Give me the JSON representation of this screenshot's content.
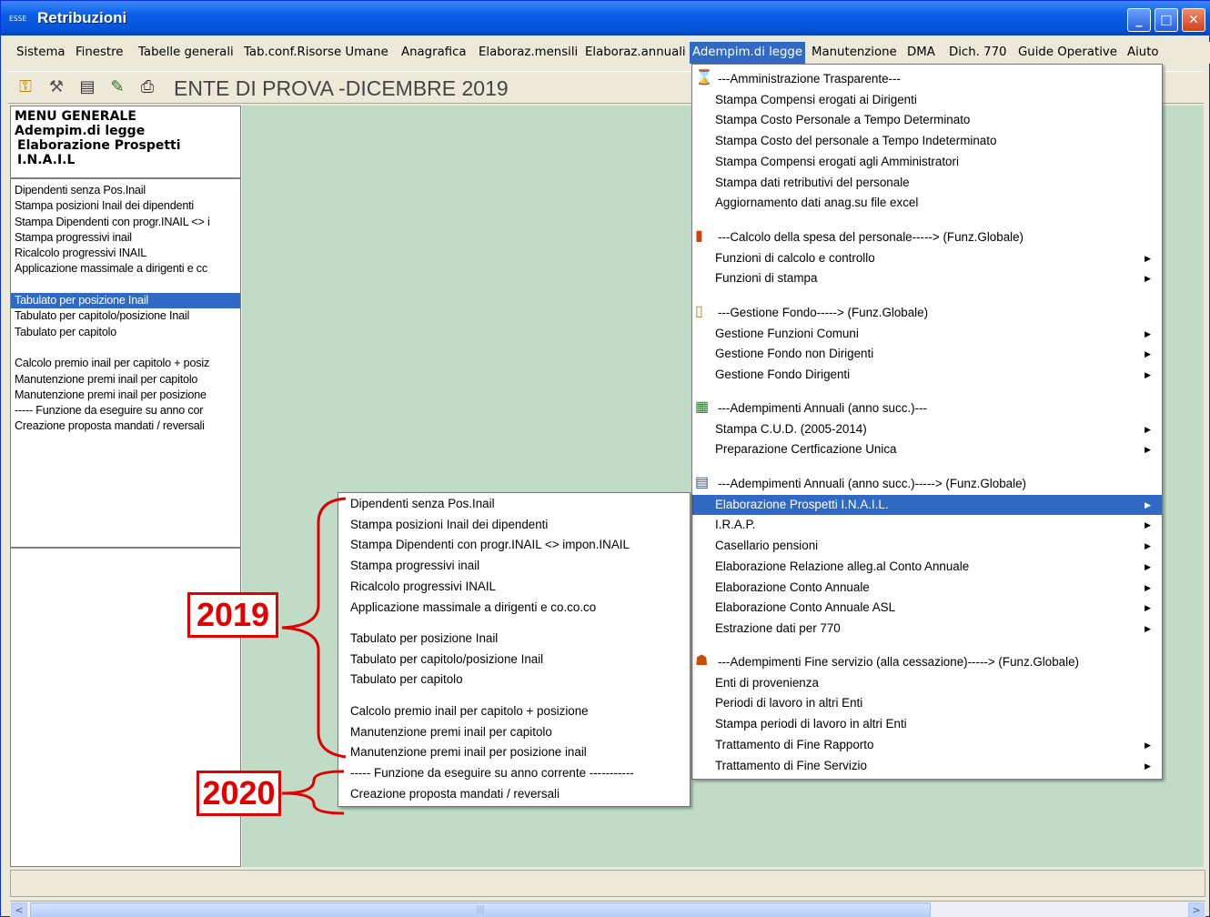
{
  "window": {
    "title": "Retribuzioni",
    "app_icon_text": "ESSE"
  },
  "menubar": [
    "Sistema",
    "Finestre",
    "Tabelle generali",
    "Tab.conf.Risorse Umane",
    "Anagrafica",
    "Elaboraz.mensili",
    "Elaboraz.annuali",
    "Adempim.di legge",
    "Manutenzione",
    "DMA",
    "Dich. 770",
    "Guide Operative",
    "Aiuto"
  ],
  "menubar_active": "Adempim.di legge",
  "toolbar": {
    "ente_label": "ENTE DI PROVA -DICEMBRE 2019",
    "icons": [
      "key-icon",
      "tools-icon",
      "form-icon",
      "edit-icon",
      "printer-icon"
    ]
  },
  "left_panel": {
    "header": [
      "MENU GENERALE",
      "Adempim.di legge",
      "Elaborazione Prospetti I.N.A.I.L"
    ],
    "items": [
      "Dipendenti senza Pos.Inail",
      "Stampa posizioni Inail dei dipendenti",
      "Stampa Dipendenti con progr.INAIL <> i",
      "Stampa progressivi inail",
      "Ricalcolo progressivi INAIL",
      "Applicazione massimale a dirigenti e cc",
      "",
      "Tabulato per posizione Inail",
      "Tabulato per capitolo/posizione Inail",
      "Tabulato per capitolo",
      "",
      "Calcolo premio inail per capitolo + posiz",
      "Manutenzione premi inail per capitolo",
      "Manutenzione premi inail per posizione",
      "----- Funzione da eseguire su anno cor",
      "Creazione proposta mandati / reversali"
    ],
    "selected": "Tabulato per posizione Inail"
  },
  "adempim_menu": {
    "groups": [
      {
        "icon": "hourglass-icon",
        "items": [
          {
            "label": "---Amministrazione Trasparente---",
            "sub": false
          },
          {
            "label": "Stampa Compensi erogati ai Dirigenti",
            "sub": false
          },
          {
            "label": "Stampa Costo Personale a Tempo Determinato",
            "sub": false
          },
          {
            "label": "Stampa Costo del personale a Tempo Indeterminato",
            "sub": false
          },
          {
            "label": "Stampa Compensi erogati agli Amministratori",
            "sub": false
          },
          {
            "label": "Stampa dati retributivi del personale",
            "sub": false
          },
          {
            "label": "Aggiornamento dati anag.su file excel",
            "sub": false
          }
        ]
      },
      {
        "icon": "chart-icon",
        "items": [
          {
            "label": "---Calcolo della spesa del personale-----> (Funz.Globale)",
            "sub": false
          },
          {
            "label": "Funzioni di calcolo e controllo",
            "sub": true
          },
          {
            "label": "Funzioni di stampa",
            "sub": true
          }
        ]
      },
      {
        "icon": "clipboard-icon",
        "items": [
          {
            "label": "---Gestione Fondo-----> (Funz.Globale)",
            "sub": false
          },
          {
            "label": "Gestione Funzioni Comuni",
            "sub": true
          },
          {
            "label": "Gestione Fondo non Dirigenti",
            "sub": true
          },
          {
            "label": "Gestione Fondo Dirigenti",
            "sub": true
          }
        ]
      },
      {
        "icon": "calendar-icon",
        "items": [
          {
            "label": "---Adempimenti Annuali (anno succ.)---",
            "sub": false
          },
          {
            "label": "Stampa C.U.D. (2005-2014)",
            "sub": true
          },
          {
            "label": "Preparazione Certficazione Unica",
            "sub": true
          }
        ]
      },
      {
        "icon": "document-icon",
        "items": [
          {
            "label": "---Adempimenti Annuali (anno succ.)-----> (Funz.Globale)",
            "sub": false
          },
          {
            "label": "Elaborazione Prospetti I.N.A.I.L.",
            "sub": true
          },
          {
            "label": "I.R.A.P.",
            "sub": true
          },
          {
            "label": "Casellario pensioni",
            "sub": true
          },
          {
            "label": "Elaborazione Relazione alleg.al Conto Annuale",
            "sub": true
          },
          {
            "label": "Elaborazione Conto Annuale",
            "sub": true
          },
          {
            "label": "Elaborazione Conto Annuale ASL",
            "sub": true
          },
          {
            "label": "Estrazione dati per 770",
            "sub": true
          }
        ]
      },
      {
        "icon": "people-icon",
        "items": [
          {
            "label": "---Adempimenti Fine servizio (alla cessazione)-----> (Funz.Globale)",
            "sub": false
          },
          {
            "label": "Enti di provenienza",
            "sub": false
          },
          {
            "label": "Periodi di lavoro in altri Enti",
            "sub": false
          },
          {
            "label": "Stampa periodi di lavoro in altri Enti",
            "sub": false
          },
          {
            "label": "Trattamento di Fine Rapporto",
            "sub": true
          },
          {
            "label": "Trattamento di Fine Servizio",
            "sub": true
          }
        ]
      }
    ],
    "highlighted": "Elaborazione Prospetti I.N.A.I.L."
  },
  "inail_submenu": {
    "groups": [
      [
        "Dipendenti senza Pos.Inail",
        "Stampa posizioni Inail dei dipendenti",
        "Stampa Dipendenti con progr.INAIL <> impon.INAIL",
        "Stampa progressivi inail",
        "Ricalcolo progressivi INAIL",
        "Applicazione massimale a dirigenti e co.co.co"
      ],
      [
        "Tabulato per posizione Inail",
        "Tabulato per capitolo/posizione Inail",
        "Tabulato per capitolo"
      ],
      [
        "Calcolo premio inail per capitolo + posizione",
        "Manutenzione premi inail per capitolo",
        "Manutenzione premi inail per posizione inail",
        "----- Funzione da eseguire su anno corrente -----------",
        "Creazione proposta mandati / reversali"
      ]
    ]
  },
  "annotations": {
    "label_2019": "2019",
    "label_2020": "2020",
    "color": "#e00000"
  },
  "scrollbar": {
    "left_arrow": "<",
    "right_arrow": ">",
    "grip": "|||"
  },
  "colors": {
    "titlebar": "#0553d6",
    "highlight": "#316ac5",
    "mdi_background": "#c0dcc6",
    "chrome": "#ece9d8"
  }
}
